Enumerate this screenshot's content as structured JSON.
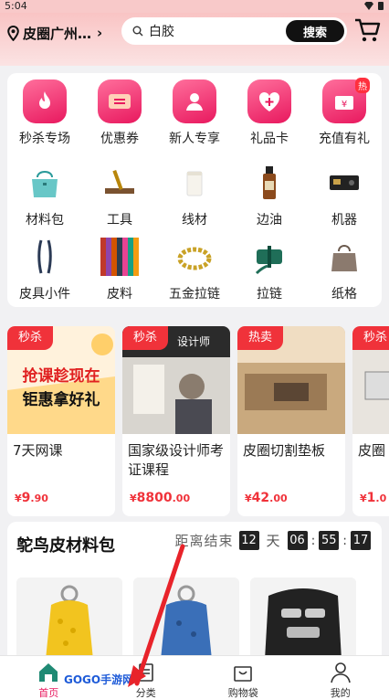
{
  "status": {
    "time": "5:04"
  },
  "header": {
    "location": "皮圈广州…",
    "location_chevron": "›",
    "search_value": "白胶",
    "search_button": "搜索"
  },
  "quick_links": [
    {
      "label": "秒杀专场",
      "icon": "flame-icon"
    },
    {
      "label": "优惠券",
      "icon": "coupon-icon"
    },
    {
      "label": "新人专享",
      "icon": "new-user-icon"
    },
    {
      "label": "礼品卡",
      "icon": "gift-card-icon"
    },
    {
      "label": "充值有礼",
      "icon": "recharge-gift-icon",
      "badge": "热"
    }
  ],
  "categories_row2": [
    {
      "label": "材料包"
    },
    {
      "label": "工具"
    },
    {
      "label": "线材"
    },
    {
      "label": "边油"
    },
    {
      "label": "机器"
    }
  ],
  "categories_row3": [
    {
      "label": "皮具小件"
    },
    {
      "label": "皮料"
    },
    {
      "label": "五金拉链"
    },
    {
      "label": "拉链"
    },
    {
      "label": "纸格"
    }
  ],
  "promos": [
    {
      "tag": "秒杀",
      "title": "7天网课",
      "currency": "¥",
      "price_int": "9",
      "price_dec": ".90",
      "img_text": "抢课趁现在 钜惠拿好礼"
    },
    {
      "tag": "秒杀",
      "title": "国家级设计师考证课程",
      "currency": "¥",
      "price_int": "8800",
      "price_dec": ".00",
      "img_text": "设计师"
    },
    {
      "tag": "热卖",
      "title": "皮圈切割垫板",
      "currency": "¥",
      "price_int": "42",
      "price_dec": ".00",
      "img_text": ""
    },
    {
      "tag": "秒杀",
      "title": "皮圈",
      "currency": "¥",
      "price_int": "1",
      "price_dec": ".0",
      "img_text": ""
    }
  ],
  "ostrich": {
    "title": "鸵鸟皮材料包",
    "countdown_label": "距离结束",
    "days": "12",
    "day_unit": "天",
    "hours": "06",
    "minutes": "55",
    "seconds": "17",
    "sep": ":"
  },
  "tabs": [
    {
      "label": "首页",
      "icon": "home-icon"
    },
    {
      "label": "分类",
      "icon": "category-icon"
    },
    {
      "label": "购物袋",
      "icon": "shopping-bag-icon"
    },
    {
      "label": "我的",
      "icon": "profile-icon"
    }
  ],
  "watermark": "GOGO手游网",
  "colors": {
    "accent": "#e8185e",
    "price": "#f0323a",
    "header_bg": "#f9c4c4"
  }
}
